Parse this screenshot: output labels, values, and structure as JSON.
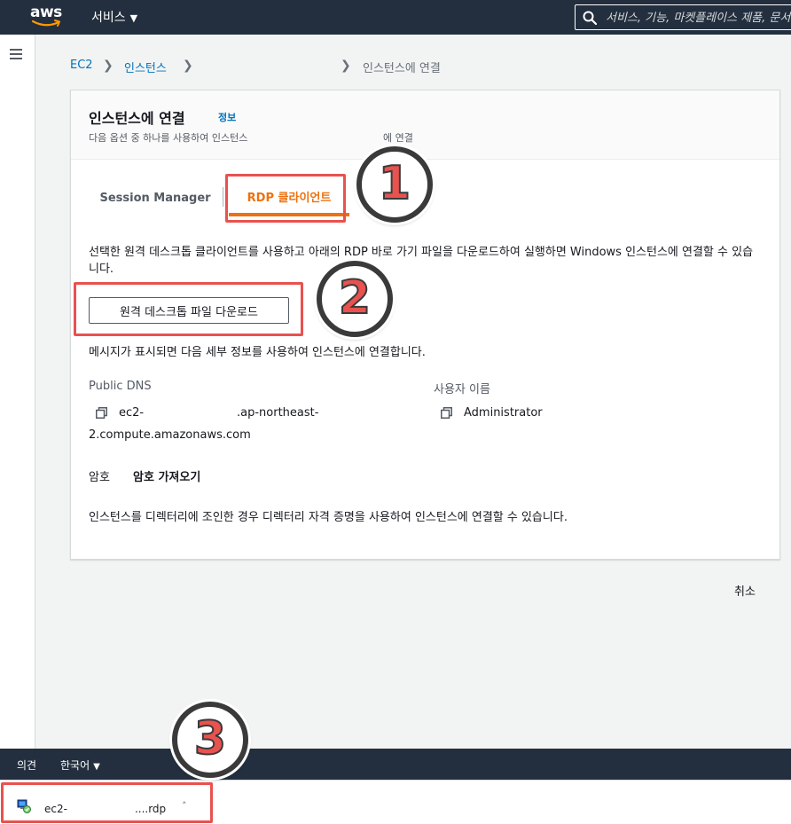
{
  "topnav": {
    "logo_text": "aws",
    "services_label": "서비스",
    "search_placeholder": "서비스, 기능, 마켓플레이스 제품, 문서 검색"
  },
  "breadcrumb": {
    "ec2": "EC2",
    "instances": "인스턴스",
    "current": "인스턴스에 연결"
  },
  "panel": {
    "title": "인스턴스에 연결",
    "info_link": "정보",
    "desc_part1": "다음 옵션 중 하나를 사용하여 인스턴스",
    "desc_part2": "에 연결"
  },
  "tabs": {
    "session_manager": "Session Manager",
    "rdp_client": "RDP 클라이언트",
    "active": "rdp_client"
  },
  "rdp": {
    "description": "선택한 원격 데스크톱 클라이언트를 사용하고 아래의 RDP 바로 가기 파일을 다운로드하여 실행하면 Windows 인스턴스에 연결할 수 있습니다.",
    "download_button": "원격 데스크톱 파일 다운로드",
    "prompt_text": "메시지가 표시되면 다음 세부 정보를 사용하여 인스턴스에 연결합니다.",
    "public_dns_label": "Public DNS",
    "public_dns_part1": "ec2-",
    "public_dns_part2": ".ap-northeast-",
    "public_dns_part3": "2.compute.amazonaws.com",
    "username_label": "사용자 이름",
    "username_value": "Administrator",
    "password_label": "암호",
    "get_password": "암호 가져오기",
    "directory_text": "인스턴스를 디렉터리에 조인한 경우 디렉터리 자격 증명을 사용하여 인스턴스에 연결할 수 있습니다."
  },
  "cancel_label": "취소",
  "footer": {
    "feedback": "의견",
    "language": "한국어"
  },
  "download_shelf": {
    "filename_part1": "ec2-",
    "filename_part2": "....rdp"
  },
  "annotations": {
    "circle_1": "1",
    "circle_2": "2",
    "circle_3": "3",
    "color": "#e8524f"
  },
  "colors": {
    "nav_bg": "#232f3e",
    "link": "#0073bb",
    "active_tab": "#ec7211"
  }
}
